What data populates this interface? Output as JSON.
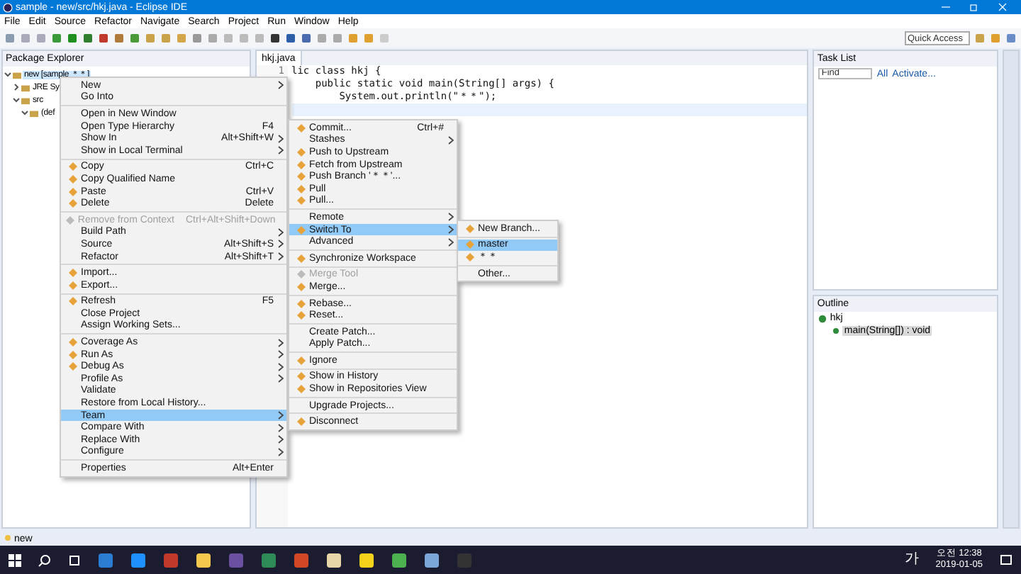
{
  "window": {
    "title": "sample - new/src/hkj.java - Eclipse IDE"
  },
  "menu_bar": [
    "File",
    "Edit",
    "Source",
    "Refactor",
    "Navigate",
    "Search",
    "Project",
    "Run",
    "Window",
    "Help"
  ],
  "quick_access": {
    "placeholder": "Quick Access"
  },
  "package_explorer": {
    "title": "Package Explorer",
    "tree": [
      {
        "label": "new [sample ＊＊]",
        "selected": true,
        "expanded": true,
        "children": [
          {
            "label": "JRE Sy",
            "selected": false,
            "expanded": false
          },
          {
            "label": "src",
            "selected": false,
            "expanded": true,
            "children": [
              {
                "label": "(def",
                "selected": false,
                "expanded": true
              }
            ]
          }
        ]
      }
    ]
  },
  "editor": {
    "tab": "hkj.java",
    "line_numbers": [
      "1"
    ],
    "lines": [
      "lic class hkj {",
      "    public static void main(String[] args) {",
      "        System.out.println(\"＊＊\");"
    ]
  },
  "task_list": {
    "title": "Task List",
    "find": {
      "placeholder": "Find"
    },
    "filters": [
      "All",
      "Activate..."
    ]
  },
  "outline": {
    "title": "Outline",
    "tree": [
      {
        "label": "hkj",
        "children": [
          {
            "label": "main(String[]) : void",
            "selected": true
          }
        ]
      }
    ]
  },
  "context_menu": [
    [
      {
        "label": "New",
        "submenu": true,
        "selected": false,
        "disabled": false,
        "icon": false
      },
      {
        "label": "Go Into",
        "submenu": false,
        "selected": false,
        "disabled": false,
        "icon": false
      }
    ],
    [
      {
        "label": "Open in New Window",
        "submenu": false,
        "selected": false,
        "disabled": false,
        "icon": false
      },
      {
        "label": "Open Type Hierarchy",
        "shortcut": "F4",
        "submenu": false,
        "selected": false,
        "disabled": false,
        "icon": false
      },
      {
        "label": "Show In",
        "shortcut": "Alt+Shift+W",
        "submenu": true,
        "selected": false,
        "disabled": false,
        "icon": false
      },
      {
        "label": "Show in Local Terminal",
        "submenu": true,
        "selected": false,
        "disabled": false,
        "icon": false
      }
    ],
    [
      {
        "label": "Copy",
        "shortcut": "Ctrl+C",
        "submenu": false,
        "selected": false,
        "disabled": false,
        "icon": true
      },
      {
        "label": "Copy Qualified Name",
        "submenu": false,
        "selected": false,
        "disabled": false,
        "icon": true
      },
      {
        "label": "Paste",
        "shortcut": "Ctrl+V",
        "submenu": false,
        "selected": false,
        "disabled": false,
        "icon": true
      },
      {
        "label": "Delete",
        "shortcut": "Delete",
        "submenu": false,
        "selected": false,
        "disabled": false,
        "icon": true
      }
    ],
    [
      {
        "label": "Remove from Context",
        "shortcut": "Ctrl+Alt+Shift+Down",
        "submenu": false,
        "selected": false,
        "disabled": true,
        "icon": true
      },
      {
        "label": "Build Path",
        "submenu": true,
        "selected": false,
        "disabled": false,
        "icon": false
      },
      {
        "label": "Source",
        "shortcut": "Alt+Shift+S",
        "submenu": true,
        "selected": false,
        "disabled": false,
        "icon": false
      },
      {
        "label": "Refactor",
        "shortcut": "Alt+Shift+T",
        "submenu": true,
        "selected": false,
        "disabled": false,
        "icon": false
      }
    ],
    [
      {
        "label": "Import...",
        "submenu": false,
        "selected": false,
        "disabled": false,
        "icon": true
      },
      {
        "label": "Export...",
        "submenu": false,
        "selected": false,
        "disabled": false,
        "icon": true
      }
    ],
    [
      {
        "label": "Refresh",
        "shortcut": "F5",
        "submenu": false,
        "selected": false,
        "disabled": false,
        "icon": true
      },
      {
        "label": "Close Project",
        "submenu": false,
        "selected": false,
        "disabled": false,
        "icon": false
      },
      {
        "label": "Assign Working Sets...",
        "submenu": false,
        "selected": false,
        "disabled": false,
        "icon": false
      }
    ],
    [
      {
        "label": "Coverage As",
        "submenu": true,
        "selected": false,
        "disabled": false,
        "icon": true
      },
      {
        "label": "Run As",
        "submenu": true,
        "selected": false,
        "disabled": false,
        "icon": true
      },
      {
        "label": "Debug As",
        "submenu": true,
        "selected": false,
        "disabled": false,
        "icon": true
      },
      {
        "label": "Profile As",
        "submenu": true,
        "selected": false,
        "disabled": false,
        "icon": false
      },
      {
        "label": "Validate",
        "submenu": false,
        "selected": false,
        "disabled": false,
        "icon": false
      },
      {
        "label": "Restore from Local History...",
        "submenu": false,
        "selected": false,
        "disabled": false,
        "icon": false
      },
      {
        "label": "Team",
        "submenu": true,
        "selected": true,
        "disabled": false,
        "icon": false
      },
      {
        "label": "Compare With",
        "submenu": true,
        "selected": false,
        "disabled": false,
        "icon": false
      },
      {
        "label": "Replace With",
        "submenu": true,
        "selected": false,
        "disabled": false,
        "icon": false
      },
      {
        "label": "Configure",
        "submenu": true,
        "selected": false,
        "disabled": false,
        "icon": false
      }
    ],
    [
      {
        "label": "Properties",
        "shortcut": "Alt+Enter",
        "submenu": false,
        "selected": false,
        "disabled": false,
        "icon": false
      }
    ]
  ],
  "team_menu": [
    [
      {
        "label": "Commit...",
        "shortcut": "Ctrl+#",
        "submenu": false,
        "selected": false,
        "disabled": false,
        "icon": true
      },
      {
        "label": "Stashes",
        "submenu": true,
        "selected": false,
        "disabled": false,
        "icon": false
      },
      {
        "label": "Push to Upstream",
        "submenu": false,
        "selected": false,
        "disabled": false,
        "icon": true
      },
      {
        "label": "Fetch from Upstream",
        "submenu": false,
        "selected": false,
        "disabled": false,
        "icon": true
      },
      {
        "label": "Push Branch '＊＊'...",
        "submenu": false,
        "selected": false,
        "disabled": false,
        "icon": true
      },
      {
        "label": "Pull",
        "submenu": false,
        "selected": false,
        "disabled": false,
        "icon": true
      },
      {
        "label": "Pull...",
        "submenu": false,
        "selected": false,
        "disabled": false,
        "icon": true
      }
    ],
    [
      {
        "label": "Remote",
        "submenu": true,
        "selected": false,
        "disabled": false,
        "icon": false
      },
      {
        "label": "Switch To",
        "submenu": true,
        "selected": true,
        "disabled": false,
        "icon": true
      },
      {
        "label": "Advanced",
        "submenu": true,
        "selected": false,
        "disabled": false,
        "icon": false
      }
    ],
    [
      {
        "label": "Synchronize Workspace",
        "submenu": false,
        "selected": false,
        "disabled": false,
        "icon": true
      }
    ],
    [
      {
        "label": "Merge Tool",
        "submenu": false,
        "selected": false,
        "disabled": true,
        "icon": true
      },
      {
        "label": "Merge...",
        "submenu": false,
        "selected": false,
        "disabled": false,
        "icon": true
      }
    ],
    [
      {
        "label": "Rebase...",
        "submenu": false,
        "selected": false,
        "disabled": false,
        "icon": true
      },
      {
        "label": "Reset...",
        "submenu": false,
        "selected": false,
        "disabled": false,
        "icon": true
      }
    ],
    [
      {
        "label": "Create Patch...",
        "submenu": false,
        "selected": false,
        "disabled": false,
        "icon": false
      },
      {
        "label": "Apply Patch...",
        "submenu": false,
        "selected": false,
        "disabled": false,
        "icon": false
      }
    ],
    [
      {
        "label": "Ignore",
        "submenu": false,
        "selected": false,
        "disabled": false,
        "icon": true
      }
    ],
    [
      {
        "label": "Show in History",
        "submenu": false,
        "selected": false,
        "disabled": false,
        "icon": true
      },
      {
        "label": "Show in Repositories View",
        "submenu": false,
        "selected": false,
        "disabled": false,
        "icon": true
      }
    ],
    [
      {
        "label": "Upgrade Projects...",
        "submenu": false,
        "selected": false,
        "disabled": false,
        "icon": false
      }
    ],
    [
      {
        "label": "Disconnect",
        "submenu": false,
        "selected": false,
        "disabled": false,
        "icon": true
      }
    ]
  ],
  "switch_menu": [
    [
      {
        "label": "New Branch...",
        "submenu": false,
        "selected": false,
        "disabled": false,
        "icon": true
      }
    ],
    [
      {
        "label": "master",
        "submenu": false,
        "selected": true,
        "disabled": false,
        "icon": true
      },
      {
        "label": "＊＊",
        "submenu": false,
        "selected": false,
        "disabled": false,
        "icon": true
      }
    ],
    [
      {
        "label": "Other...",
        "submenu": false,
        "selected": false,
        "disabled": false,
        "icon": false
      }
    ]
  ],
  "status_bar": {
    "text": "new"
  },
  "taskbar": {
    "ime": "가",
    "time": "오전 12:38",
    "date": "2019-01-05"
  }
}
